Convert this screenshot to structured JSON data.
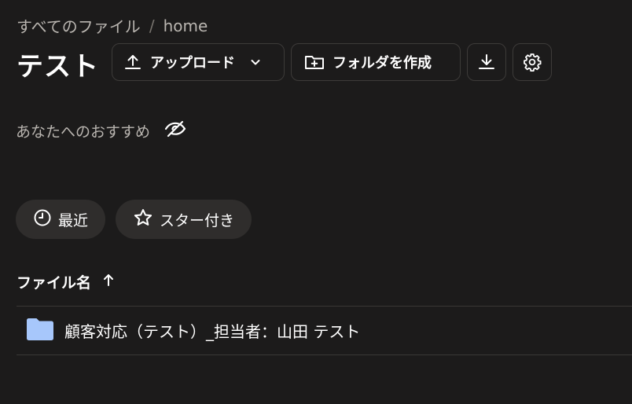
{
  "breadcrumb": {
    "root": "すべてのファイル",
    "separator": "/",
    "current": "home"
  },
  "page_title": "テスト",
  "toolbar": {
    "upload_label": "アップロード",
    "new_folder_label": "フォルダを作成",
    "download_icon": "download-icon",
    "settings_icon": "gear-icon"
  },
  "recommendations": {
    "label": "あなたへのおすすめ",
    "toggle_icon": "eye-off-icon"
  },
  "filters": [
    {
      "label": "最近",
      "icon": "clock-icon"
    },
    {
      "label": "スター付き",
      "icon": "star-icon"
    }
  ],
  "file_list": {
    "column_header": "ファイル名",
    "sort": "ascending",
    "rows": [
      {
        "type": "folder",
        "name": "顧客対応（テスト）_担当者：山田 テスト"
      }
    ]
  },
  "colors": {
    "background": "#1c1b1b",
    "chip_bg": "#2f2d2c",
    "folder": "#a7c7fb",
    "muted_text": "#b9b5b0"
  }
}
